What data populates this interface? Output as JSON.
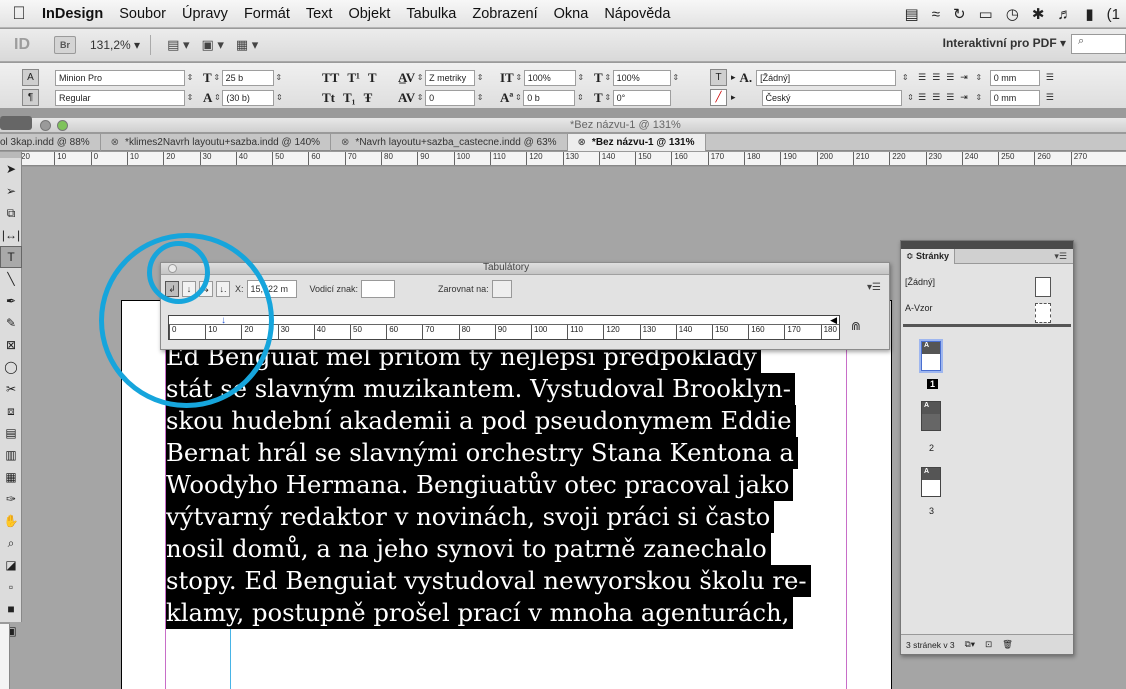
{
  "menubar": {
    "app": "InDesign",
    "items": [
      "Soubor",
      "Úpravy",
      "Formát",
      "Text",
      "Objekt",
      "Tabulka",
      "Zobrazení",
      "Okna",
      "Nápověda"
    ],
    "clock": "(1"
  },
  "appbar": {
    "logo": "ID",
    "bridge": "Br",
    "zoom": "131,2% ▾",
    "workspace": "Interaktivní pro PDF ▾",
    "search_placeholder": "⌕"
  },
  "control": {
    "font": "Minion Pro",
    "style": "Regular",
    "size": "25 b",
    "leading": "(30 b)",
    "kerning": "Z metriky",
    "tracking": "0",
    "vscale": "100%",
    "hscale": "100%",
    "baseline": "0 b",
    "skew": "0°",
    "char_style": "[Žádný]",
    "language": "Český",
    "indent_left": "0 mm",
    "indent_first": "0 mm"
  },
  "document": {
    "title": "*Bez názvu-1 @ 131%",
    "tabs": [
      "ol 3kap.indd @ 88%",
      "*klimes2Navrh layoutu+sazba.indd @ 140%",
      "*Navrh layoutu+sazba_castecne.indd @ 63%",
      "*Bez názvu-1 @ 131%"
    ]
  },
  "ruler": [
    "20",
    "10",
    "0",
    "10",
    "20",
    "30",
    "40",
    "50",
    "60",
    "70",
    "80",
    "90",
    "100",
    "110",
    "120",
    "130",
    "140",
    "150",
    "160",
    "170",
    "180",
    "190",
    "200",
    "210",
    "220",
    "230",
    "240",
    "250",
    "260",
    "270"
  ],
  "tabs_panel": {
    "title": "Tabulátory",
    "x_label": "X:",
    "x_value": "15,522 m",
    "leader_label": "Vodicí znak:",
    "leader_value": "",
    "align_label": "Zarovnat na:",
    "align_value": "",
    "ruler": [
      "0",
      "10",
      "20",
      "30",
      "40",
      "50",
      "60",
      "70",
      "80",
      "90",
      "100",
      "110",
      "120",
      "130",
      "140",
      "150",
      "160",
      "170",
      "180"
    ]
  },
  "body_text": [
    "Ed Benguiat měl přitom ty nejlepší předpoklady",
    "stát se slavným muzikantem. Vystudoval Brooklyn-",
    "skou hudební akademii a pod pseudonymem Eddie",
    "Bernat hrál se slavnými orchestry Stana Kentona a",
    "Woodyho Hermana. Bengiuatův otec pracoval jako",
    "výtvarný redaktor v novinách, svoji práci si často",
    "nosil domů, a na jeho synovi to patrně zanechalo",
    "stopy. Ed Benguiat vystudoval newyorskou školu re-",
    "klamy, postupně prošel prací v mnoha agenturách,"
  ],
  "pages_panel": {
    "tab": "≎ Stránky",
    "none_master": "[Žádný]",
    "a_master": "A-Vzor",
    "thumb_letter": "A",
    "pages": [
      "1",
      "2",
      "3"
    ],
    "footer": "3 stránek v 3"
  }
}
